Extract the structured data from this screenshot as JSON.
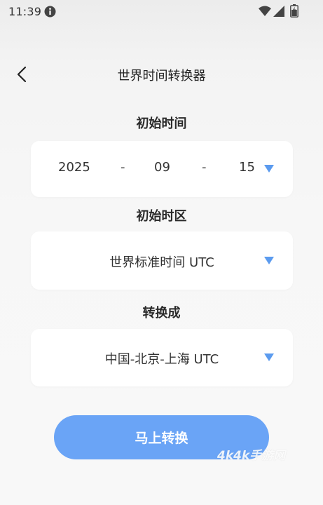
{
  "status_bar": {
    "time": "11:39",
    "icons": [
      "info-icon",
      "wifi-icon",
      "signal-icon",
      "battery-icon"
    ]
  },
  "header": {
    "title": "世界时间转换器",
    "back_icon": "chevron-left-icon"
  },
  "sections": {
    "start_time_label": "初始时间",
    "start_timezone_label": "初始时区",
    "convert_to_label": "转换成"
  },
  "date_picker": {
    "year": "2025",
    "separator": "-",
    "month": "09",
    "day": "15"
  },
  "start_timezone": {
    "value": "世界标准时间 UTC"
  },
  "target_timezone": {
    "value": "中国-北京-上海 UTC"
  },
  "actions": {
    "convert_label": "马上转换"
  },
  "watermark": {
    "text": "4k4k手游网"
  },
  "colors": {
    "accent": "#6aa4f6",
    "dropdown_arrow": "#5b9bef",
    "background": "#f7f7f7",
    "card": "#ffffff"
  }
}
